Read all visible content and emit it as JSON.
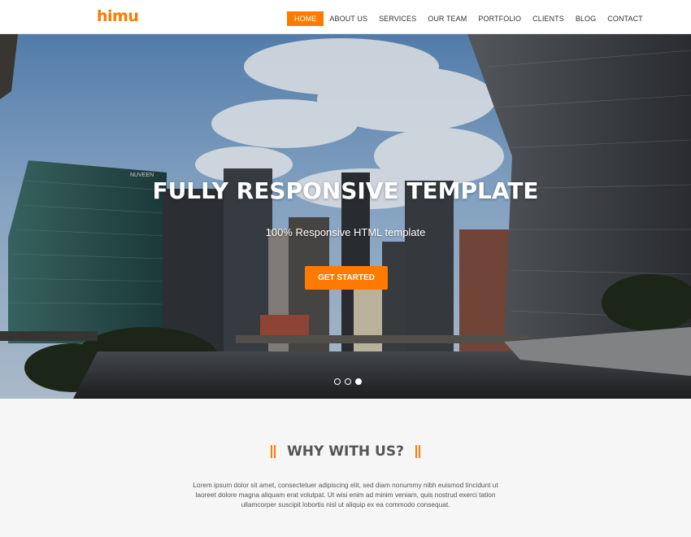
{
  "header": {
    "logo": "himu",
    "nav": [
      "HOME",
      "ABOUT US",
      "SERVICES",
      "OUR TEAM",
      "PORTFOLIO",
      "CLIENTS",
      "BLOG",
      "CONTACT"
    ]
  },
  "hero": {
    "title": "FULLY RESPONSIVE TEMPLATE",
    "subtitle": "100% Responsive HTML template",
    "cta": "GET STARTED",
    "building_sign": "NUVEEN",
    "slides_total": 3,
    "slide_active": 3
  },
  "why": {
    "title": "WHY WITH US?",
    "text": "Lorem ipsum dolor sit amet, consectetuer adipiscing elit, sed diam nonummy nibh euismod tincidunt ut laoreet dolore magna aliquam erat volutpat. Ut wisi enim ad minim veniam, quis nostrud exerci tation ullamcorper suscipit lobortis nisl ut aliquip ex ea commodo consequat."
  },
  "colors": {
    "accent": "#ff7a00",
    "header_bg": "#ffffff",
    "section_bg": "#f6f6f6"
  }
}
